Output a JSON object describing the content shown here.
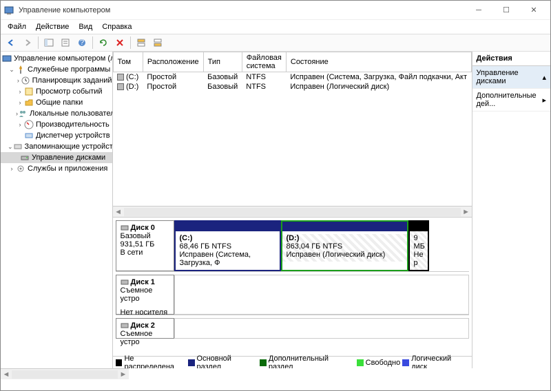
{
  "window": {
    "title": "Управление компьютером"
  },
  "menu": {
    "file": "Файл",
    "action": "Действие",
    "view": "Вид",
    "help": "Справка"
  },
  "tree": {
    "root": "Управление компьютером (л",
    "sys_tools": "Служебные программы",
    "scheduler": "Планировщик заданий",
    "eventv": "Просмотр событий",
    "shared": "Общие папки",
    "users": "Локальные пользовател",
    "perf": "Производительность",
    "devmgr": "Диспетчер устройств",
    "storage": "Запоминающие устройст",
    "diskmgmt": "Управление дисками",
    "services": "Службы и приложения"
  },
  "cols": {
    "vol": "Том",
    "layout": "Расположение",
    "type": "Тип",
    "fs": "Файловая система",
    "status": "Состояние"
  },
  "rows": [
    {
      "vol": "(C:)",
      "layout": "Простой",
      "type": "Базовый",
      "fs": "NTFS",
      "status": "Исправен (Система, Загрузка, Файл подкачки, Акт"
    },
    {
      "vol": "(D:)",
      "layout": "Простой",
      "type": "Базовый",
      "fs": "NTFS",
      "status": "Исправен (Логический диск)"
    }
  ],
  "disks": {
    "d0": {
      "name": "Диск 0",
      "type": "Базовый",
      "size": "931,51 ГБ",
      "state": "В сети"
    },
    "d1": {
      "name": "Диск 1",
      "type": "Съемное устро",
      "media": "Нет носителя"
    },
    "d2": {
      "name": "Диск 2",
      "type": "Съемное устро"
    }
  },
  "parts": {
    "c": {
      "name": "(C:)",
      "size": "68,46 ГБ NTFS",
      "status": "Исправен (Система, Загрузка, Ф"
    },
    "d": {
      "name": "(D:)",
      "size": "863,04 ГБ NTFS",
      "status": "Исправен (Логический диск)"
    },
    "u": {
      "size": "9 МБ",
      "status": "Не р"
    }
  },
  "legend": {
    "unalloc": "Не распределена",
    "primary": "Основной раздел",
    "ext": "Дополнительный раздел",
    "free": "Свободно",
    "logical": "Логический диск"
  },
  "actions": {
    "header": "Действия",
    "diskmgmt": "Управление дисками",
    "more": "Дополнительные дей..."
  }
}
